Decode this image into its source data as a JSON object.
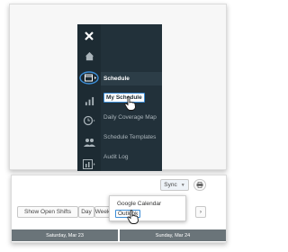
{
  "nav": {
    "section_label": "Schedule",
    "items": [
      {
        "label": "My Schedule"
      },
      {
        "label": "Daily Coverage Map"
      },
      {
        "label": "Schedule Templates"
      },
      {
        "label": "Audit Log"
      }
    ]
  },
  "toolbar": {
    "sync_label": "Sync",
    "show_open_shifts_label": "Show Open Shifts",
    "day_label": "Day",
    "week_label": "Week"
  },
  "sync_menu": {
    "items": [
      {
        "label": "Google Calendar"
      },
      {
        "label": "Outlook"
      }
    ]
  },
  "day_headers": [
    {
      "label": "Saturday, Mar 23"
    },
    {
      "label": "Sunday, Mar 24"
    }
  ],
  "colors": {
    "nav_bg": "#1d2b33",
    "accent": "#3c8dd6",
    "header_bg": "#6a7479"
  }
}
